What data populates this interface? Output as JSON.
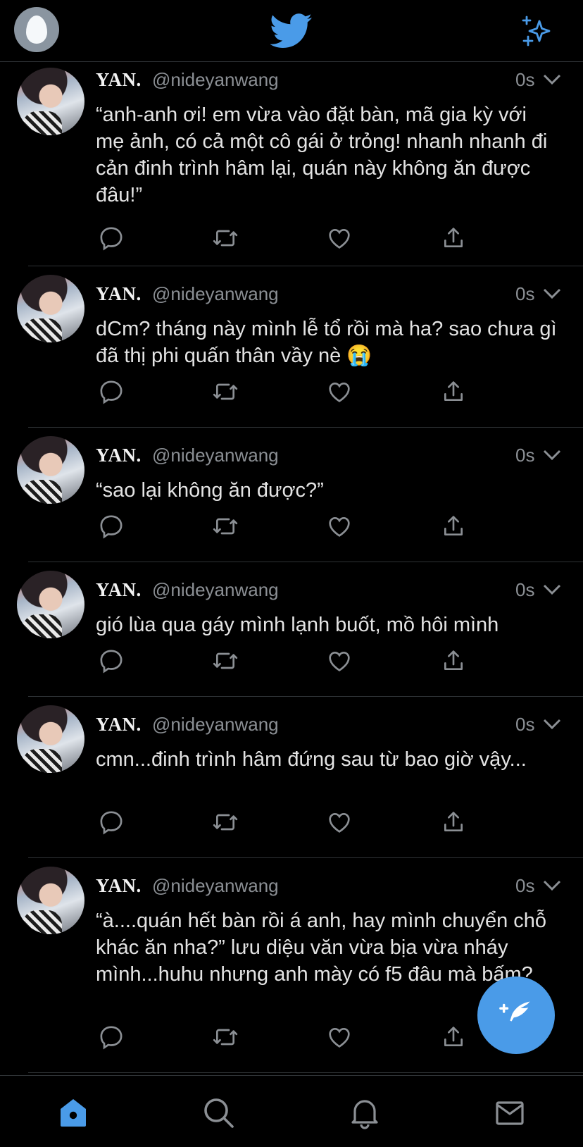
{
  "header": {
    "avatar": "egg-avatar",
    "logo": "twitter-bird-icon",
    "action": "sparkle-icon",
    "accent": "#4a9be8"
  },
  "tweets": [
    {
      "name": "YAN.",
      "handle": "@nideyanwang",
      "time": "0s",
      "text": "“anh-anh ơi! em vừa vào đặt bàn, mã gia kỳ với mẹ ảnh, có cả một cô gái ở trỏng! nhanh nhanh đi cản đinh trình hâm lại, quán này không ăn được đâu!”"
    },
    {
      "name": "YAN.",
      "handle": "@nideyanwang",
      "time": "0s",
      "text": "dCm? tháng này mình lễ tổ rồi mà ha? sao chưa gì đã thị phi quấn thân vầy nè 😭"
    },
    {
      "name": "YAN.",
      "handle": "@nideyanwang",
      "time": "0s",
      "text": "“sao lại không ăn được?”"
    },
    {
      "name": "YAN.",
      "handle": "@nideyanwang",
      "time": "0s",
      "text": "gió lùa qua gáy mình lạnh buốt, mồ hôi mình"
    },
    {
      "name": "YAN.",
      "handle": "@nideyanwang",
      "time": "0s",
      "text": "cmn...đinh trình hâm đứng sau từ bao giờ vậy..."
    },
    {
      "name": "YAN.",
      "handle": "@nideyanwang",
      "time": "0s",
      "text": "“à....quán hết bàn rồi á anh, hay mình chuyển chỗ khác ăn nha?” lưu diệu văn vừa bịa vừa nháy mình...huhu nhưng anh mày có f5 đâu mà bấm?"
    }
  ],
  "tabs": [
    "home-icon",
    "search-icon",
    "notifications-icon",
    "messages-icon"
  ]
}
